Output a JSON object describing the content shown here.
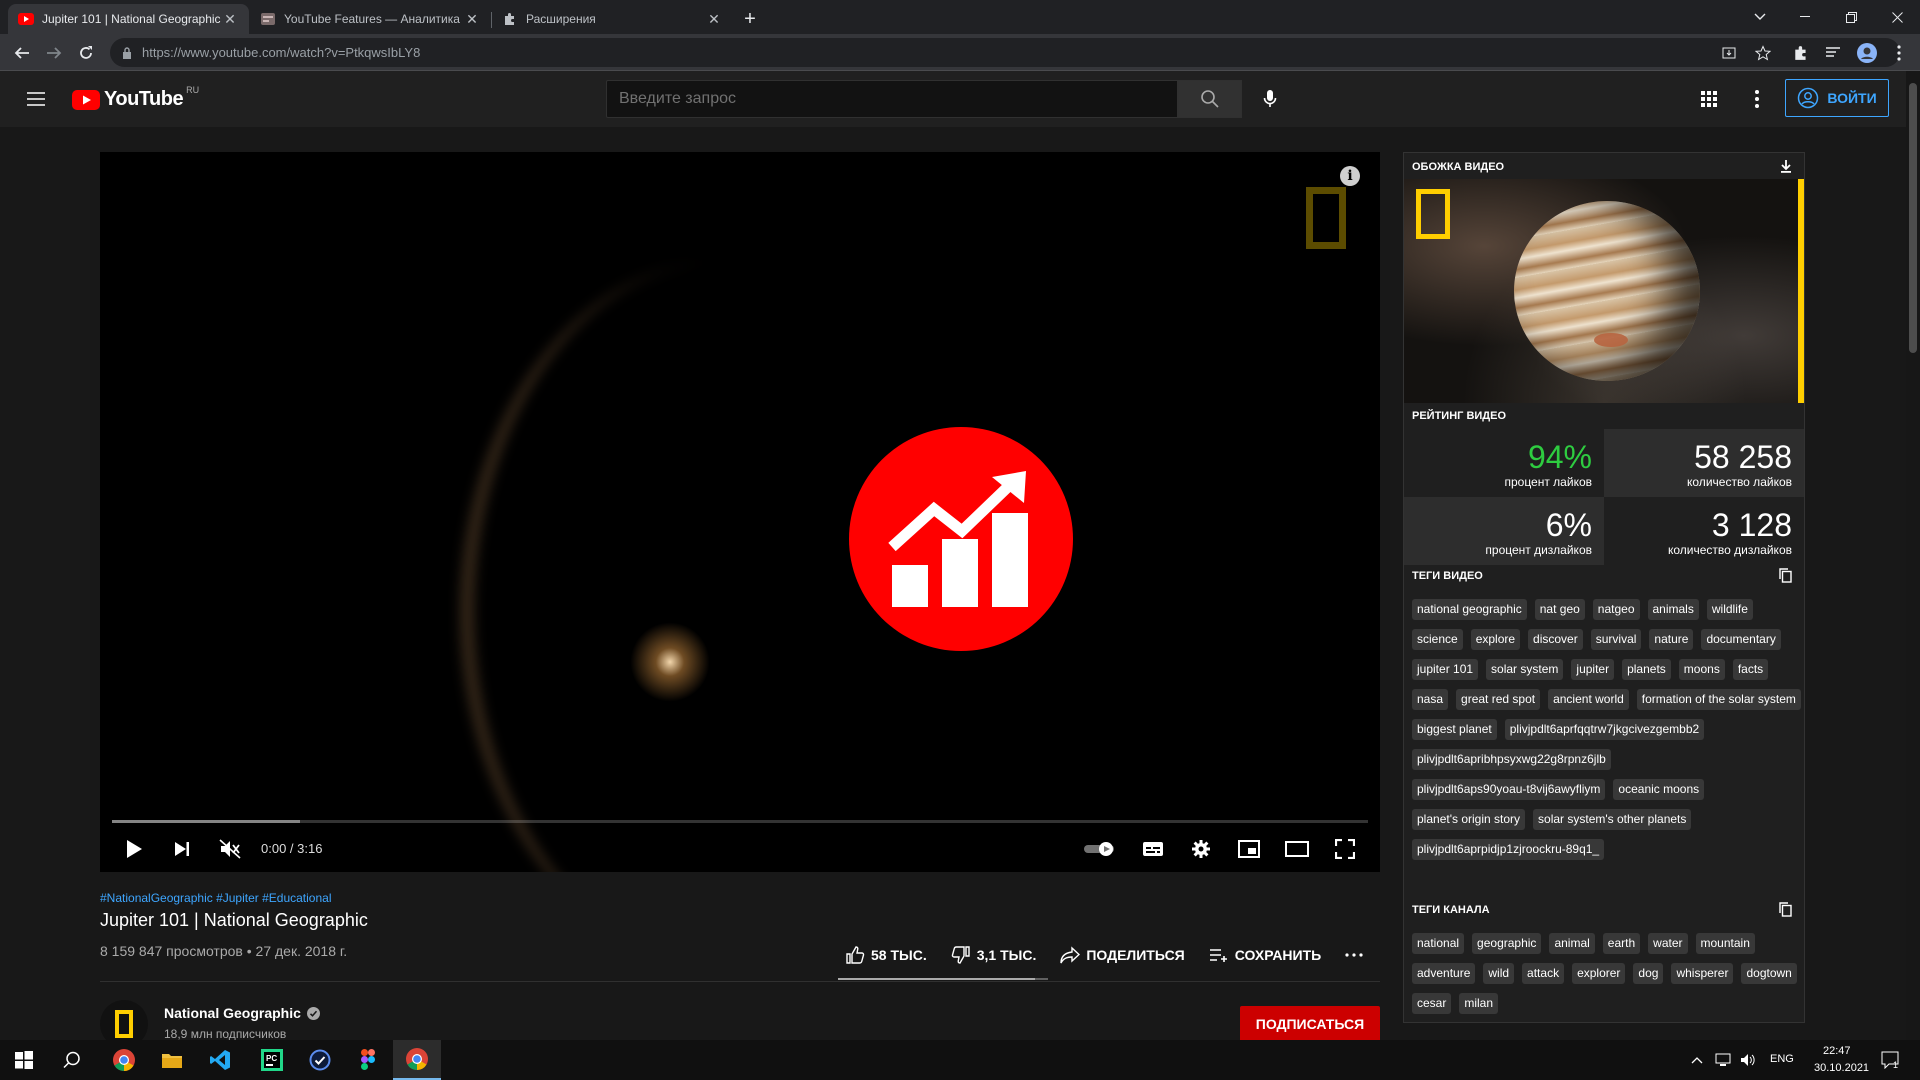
{
  "browser": {
    "tabs": [
      {
        "title": "Jupiter 101 | National Geographic",
        "icon": "youtube-favicon"
      },
      {
        "title": "YouTube Features — Аналитика",
        "icon": "extension-favicon"
      },
      {
        "title": "Расширения",
        "icon": "puzzle-icon"
      }
    ],
    "url": "https://www.youtube.com/watch?v=PtkqwsIbLY8"
  },
  "youtube": {
    "logo_word": "YouTube",
    "region": "RU",
    "search_placeholder": "Введите запрос",
    "signin_label": "ВОЙТИ"
  },
  "player": {
    "time": "0:00 / 3:16",
    "buffered_fraction": 0.15
  },
  "video": {
    "hashtags": "#NationalGeographic #Jupiter #Educational",
    "title": "Jupiter 101 | National Geographic",
    "meta": "8 159 847 просмотров • 27 дек. 2018 г.",
    "likes": "58 ТЫС.",
    "dislikes": "3,1 ТЫС.",
    "share": "ПОДЕЛИТЬСЯ",
    "save": "СОХРАНИТЬ",
    "like_ratio": 0.94
  },
  "channel": {
    "name": "National Geographic",
    "subs": "18,9 млн подписчиков",
    "subscribe": "ПОДПИСАТЬСЯ"
  },
  "panel": {
    "cover_title": "ОБОЖКА ВИДЕО",
    "rating_title": "РЕЙТИНГ ВИДЕО",
    "likes_pct": "94%",
    "likes_pct_label": "процент лайков",
    "likes_count": "58 258",
    "likes_count_label": "количество лайков",
    "dislikes_pct": "6%",
    "dislikes_pct_label": "процент дизлайков",
    "dislikes_count": "3 128",
    "dislikes_count_label": "количество дизлайков",
    "video_tags_title": "ТЕГИ ВИДЕО",
    "video_tags": [
      "national geographic",
      "nat geo",
      "natgeo",
      "animals",
      "wildlife",
      "science",
      "explore",
      "discover",
      "survival",
      "nature",
      "documentary",
      "jupiter 101",
      "solar system",
      "jupiter",
      "planets",
      "moons",
      "facts",
      "nasa",
      "great red spot",
      "ancient world",
      "formation of the solar system",
      "biggest planet",
      "plivjpdlt6aprfqqtrw7jkgcivezgembb2",
      "plivjpdlt6apribhpsyxwg22g8rpnz6jlb",
      "plivjpdlt6aps90yoau-t8vij6awyfliym",
      "oceanic moons",
      "planet's origin story",
      "solar system's other planets",
      "plivjpdlt6aprpidjp1zjroockru-89q1_"
    ],
    "channel_tags_title": "ТЕГИ КАНАЛА",
    "channel_tags": [
      "national",
      "geographic",
      "animal",
      "earth",
      "water",
      "mountain",
      "adventure",
      "wild",
      "attack",
      "explorer",
      "dog",
      "whisperer",
      "dogtown",
      "cesar",
      "milan"
    ],
    "colors": {
      "positive": "#2ecc40",
      "accent": "#ffce00"
    }
  },
  "taskbar": {
    "lang": "ENG",
    "time": "22:47",
    "date": "30.10.2021",
    "notifications": "1"
  }
}
